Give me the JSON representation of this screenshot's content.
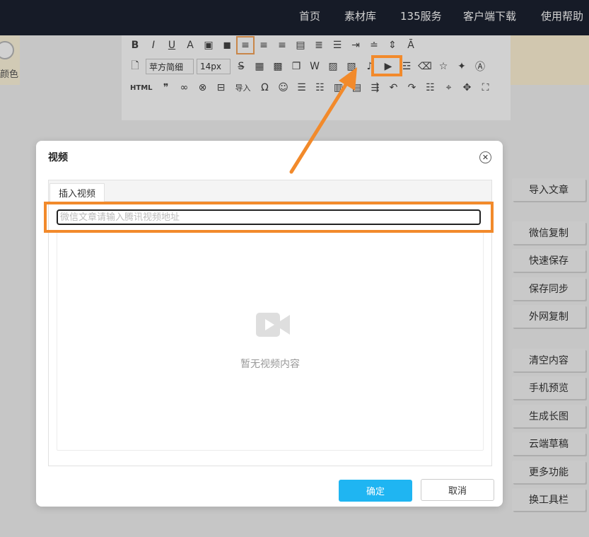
{
  "nav": {
    "items": [
      "首页",
      "素材库",
      "135服务",
      "客户端下载",
      "使用帮助"
    ]
  },
  "toolbar": {
    "font_family": "苹方简细",
    "font_size": "14px",
    "html_label": "HTML",
    "import_label": "导入"
  },
  "left_panel": {
    "label": "颜色"
  },
  "side_buttons": [
    "导入文章",
    "微信复制",
    "快速保存",
    "保存同步",
    "外网复制",
    "清空内容",
    "手机预览",
    "生成长图",
    "云端草稿",
    "更多功能",
    "换工具栏"
  ],
  "dialog": {
    "title": "视频",
    "close_icon": "close-icon",
    "tab_label": "插入视频",
    "input_placeholder": "微信文章请输入腾讯视频地址",
    "empty_text": "暂无视频内容",
    "ok_label": "确定",
    "cancel_label": "取消"
  },
  "colors": {
    "nav_bg": "#1c2130",
    "accent": "#1fb5f2",
    "highlight": "#f28a2b"
  }
}
